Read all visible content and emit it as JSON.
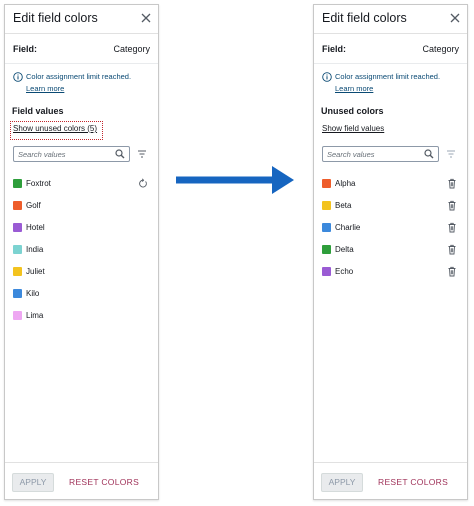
{
  "colors": {
    "accent_link": "#0a4a74",
    "reset_text": "#a0335a",
    "arrow": "#1665c0",
    "dotted_outline": "#c1272d"
  },
  "left_panel": {
    "title": "Edit field colors",
    "field_label": "Field:",
    "field_value": "Category",
    "info_text": "Color assignment limit reached.",
    "info_link": "Learn more",
    "section_title": "Field values",
    "toggle_link": "Show unused colors (5)",
    "search_placeholder": "Search values",
    "items": [
      {
        "label": "Foxtrot",
        "color": "#2e9e3b",
        "icon": "reset-icon"
      },
      {
        "label": "Golf",
        "color": "#ee5d2b",
        "icon": null
      },
      {
        "label": "Hotel",
        "color": "#9a5bd4",
        "icon": null
      },
      {
        "label": "India",
        "color": "#7cd3d1",
        "icon": null
      },
      {
        "label": "Juliet",
        "color": "#f3c31f",
        "icon": null
      },
      {
        "label": "Kilo",
        "color": "#3c89dc",
        "icon": null
      },
      {
        "label": "Lima",
        "color": "#eea7f2",
        "icon": null
      }
    ],
    "apply_label": "APPLY",
    "reset_label": "RESET COLORS"
  },
  "right_panel": {
    "title": "Edit field colors",
    "field_label": "Field:",
    "field_value": "Category",
    "info_text": "Color assignment limit reached.",
    "info_link": "Learn more",
    "section_title": "Unused colors",
    "toggle_link": "Show field values",
    "search_placeholder": "Search values",
    "items": [
      {
        "label": "Alpha",
        "color": "#ee5d2b",
        "icon": "trash-icon"
      },
      {
        "label": "Beta",
        "color": "#f3c31f",
        "icon": "trash-icon"
      },
      {
        "label": "Charlie",
        "color": "#3c89dc",
        "icon": "trash-icon"
      },
      {
        "label": "Delta",
        "color": "#2e9e3b",
        "icon": "trash-icon"
      },
      {
        "label": "Echo",
        "color": "#9a5bd4",
        "icon": "trash-icon"
      }
    ],
    "apply_label": "APPLY",
    "reset_label": "RESET COLORS"
  }
}
